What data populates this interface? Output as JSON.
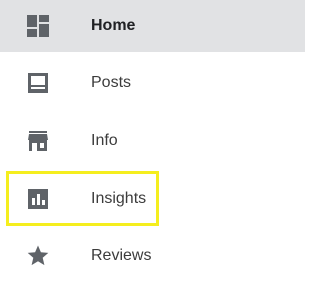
{
  "nav": {
    "items": [
      {
        "label": "Home",
        "icon": "dashboard-icon",
        "active": true
      },
      {
        "label": "Posts",
        "icon": "posts-icon",
        "active": false
      },
      {
        "label": "Info",
        "icon": "storefront-icon",
        "active": false
      },
      {
        "label": "Insights",
        "icon": "insights-icon",
        "active": false,
        "highlighted": true
      },
      {
        "label": "Reviews",
        "icon": "star-icon",
        "active": false
      }
    ]
  },
  "colors": {
    "active_background": "#e1e2e4",
    "icon": "#5f6368",
    "highlight": "#f5ee1e"
  }
}
